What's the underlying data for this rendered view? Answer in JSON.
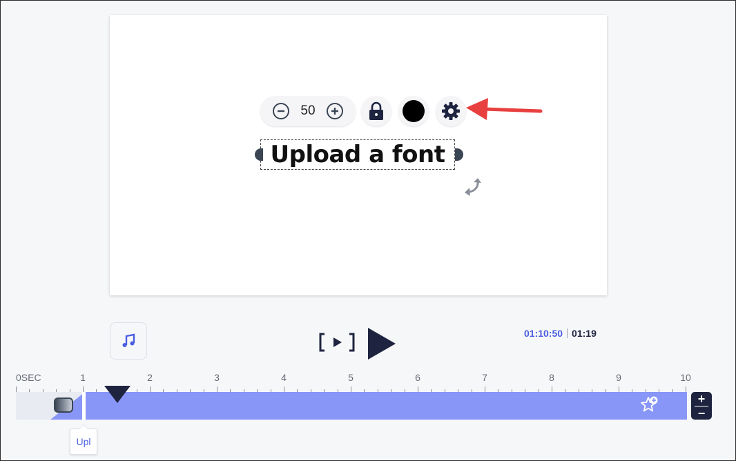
{
  "canvas": {
    "font_size_value": "50",
    "text_label": "Upload a font",
    "text_color": "#000000"
  },
  "icons": {
    "decrease": "minus-circle-icon",
    "increase": "plus-circle-icon",
    "lock": "lock-icon",
    "settings": "gear-icon",
    "rotate": "rotate-icon",
    "music": "music-note-icon",
    "preview": "preview-bracket-play-icon",
    "play": "play-icon",
    "add_effect": "star-plus-icon"
  },
  "playback": {
    "current_time": "01:10:50",
    "total_time": "01:19"
  },
  "timeline": {
    "tick_labels": [
      "0SEC",
      "1",
      "2",
      "3",
      "4",
      "5",
      "6",
      "7",
      "8",
      "9",
      "10"
    ],
    "clip_tooltip": "Upl",
    "zoom_in": "+",
    "zoom_out": "−"
  },
  "colors": {
    "accent": "#4a5ee0",
    "clip": "#8896f8",
    "dark": "#1e2440",
    "annotation_arrow": "#e8403f"
  }
}
